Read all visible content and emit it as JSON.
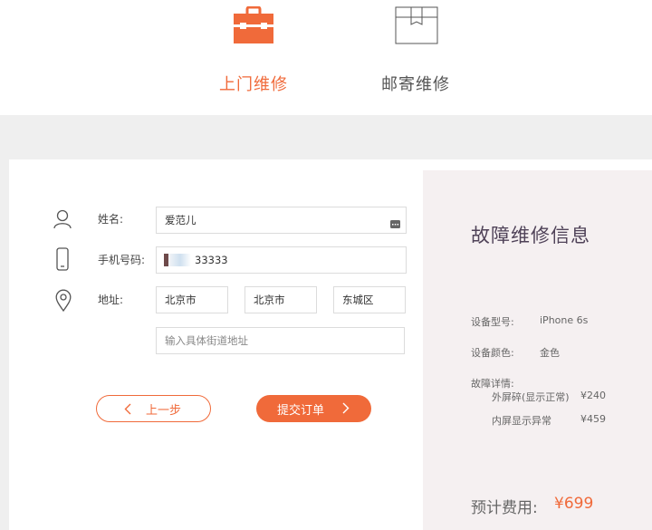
{
  "service_modes": {
    "onsite": {
      "label": "上门维修",
      "icon": "toolbox-icon",
      "active": true
    },
    "mailin": {
      "label": "邮寄维修",
      "icon": "box-icon",
      "active": false
    }
  },
  "form": {
    "name": {
      "label": "姓名:",
      "value": "爱范儿"
    },
    "phone": {
      "label": "手机号码:",
      "value": "33333"
    },
    "address": {
      "label": "地址:",
      "province": "北京市",
      "city": "北京市",
      "district": "东城区",
      "street_placeholder": "输入具体街道地址"
    }
  },
  "buttons": {
    "prev_label": "上一步",
    "submit_label": "提交订单"
  },
  "info": {
    "title": "故障维修信息",
    "device_model_label": "设备型号:",
    "device_model_value": "iPhone 6s",
    "device_color_label": "设备颜色:",
    "device_color_value": "金色",
    "fault_details_label": "故障详情:",
    "faults": [
      {
        "name": "外屏碎(显示正常)",
        "price": "¥240"
      },
      {
        "name": "内屏显示异常",
        "price": "¥459"
      }
    ],
    "total_label": "预计费用:",
    "total_value": "¥699"
  },
  "colors": {
    "accent": "#f06a3a",
    "title": "#4f4258",
    "panel": "#f5f0f1",
    "background": "#efefef"
  }
}
